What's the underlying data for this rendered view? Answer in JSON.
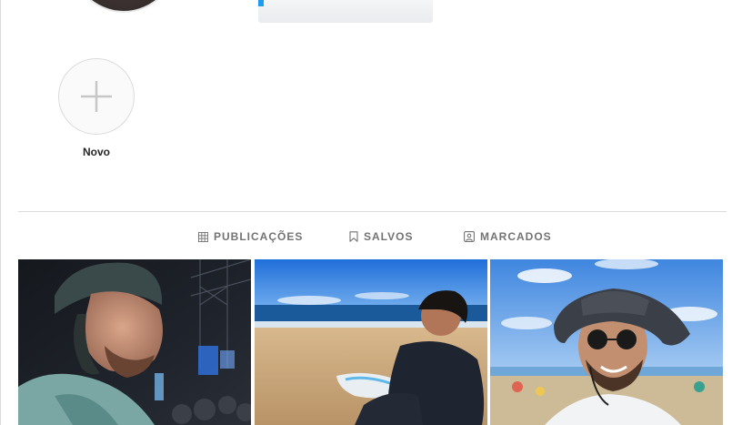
{
  "highlights": {
    "new_label": "Novo"
  },
  "tabs": [
    {
      "label": "PUBLICAÇÕES",
      "icon": "grid-icon"
    },
    {
      "label": "SALVOS",
      "icon": "bookmark-icon"
    },
    {
      "label": "MARCADOS",
      "icon": "tagged-icon"
    }
  ],
  "posts": [
    {
      "description_icon": "photo-concert-night"
    },
    {
      "description_icon": "photo-beach-surfer"
    },
    {
      "description_icon": "photo-beach-bucket-hat"
    }
  ],
  "colors": {
    "divider": "#dbdbdb",
    "tab_text": "#737373",
    "accent_blue": "#1d9bf0"
  }
}
